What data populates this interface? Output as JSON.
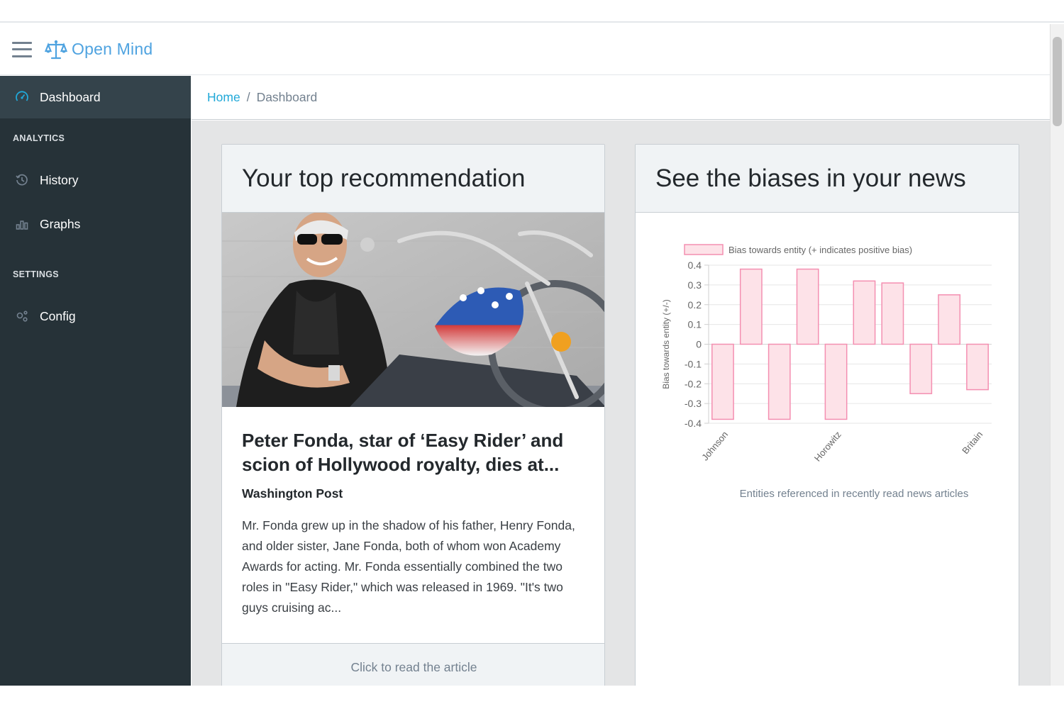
{
  "app": {
    "name": "Open Mind",
    "logo_icon": "scales-icon",
    "accent_color": "#4fa3e0"
  },
  "sidebar": {
    "active_item": {
      "label": "Dashboard",
      "icon": "speedometer-icon"
    },
    "sections": [
      {
        "title": "ANALYTICS",
        "items": [
          {
            "label": "History",
            "icon": "history-icon"
          },
          {
            "label": "Graphs",
            "icon": "bar-chart-icon"
          }
        ]
      },
      {
        "title": "SETTINGS",
        "items": [
          {
            "label": "Config",
            "icon": "gears-icon"
          }
        ]
      }
    ]
  },
  "breadcrumb": {
    "home": "Home",
    "separator": "/",
    "current": "Dashboard"
  },
  "recommendation": {
    "header": "Your top recommendation",
    "title": "Peter Fonda, star of ‘Easy Rider’ and scion of Hollywood royalty, dies at...",
    "source": "Washington Post",
    "excerpt": "Mr. Fonda grew up in the shadow of his father, Henry Fonda, and older sister, Jane Fonda, both of whom won Academy Awards for acting. Mr. Fonda essentially combined the two roles in \"Easy Rider,\" which was released in 1969. \"It's two guys cruising ac...",
    "footer_link": "Click to read the article"
  },
  "bias_card": {
    "header": "See the biases in your news",
    "caption": "Entities referenced in recently read news articles"
  },
  "chart_data": {
    "type": "bar",
    "legend": "Bias towards entity (+ indicates positive bias)",
    "legend_position": "top",
    "ylabel": "Bias towards entity (+/-)",
    "xlabel": "Entities referenced in recently read news articles",
    "ylim": [
      -0.4,
      0.4
    ],
    "yticks": [
      0.4,
      0.3,
      0.2,
      0.1,
      0,
      -0.1,
      -0.2,
      -0.3,
      -0.4
    ],
    "grid": true,
    "categories": [
      "Johnson",
      "",
      "",
      "",
      "Horowitz",
      "",
      "",
      "",
      "",
      "Britain"
    ],
    "values": [
      -0.38,
      0.38,
      -0.38,
      0.38,
      -0.38,
      0.32,
      0.31,
      -0.25,
      0.25,
      -0.23
    ],
    "bar_fill": "#fde2e8",
    "bar_stroke": "#f48fb1"
  }
}
